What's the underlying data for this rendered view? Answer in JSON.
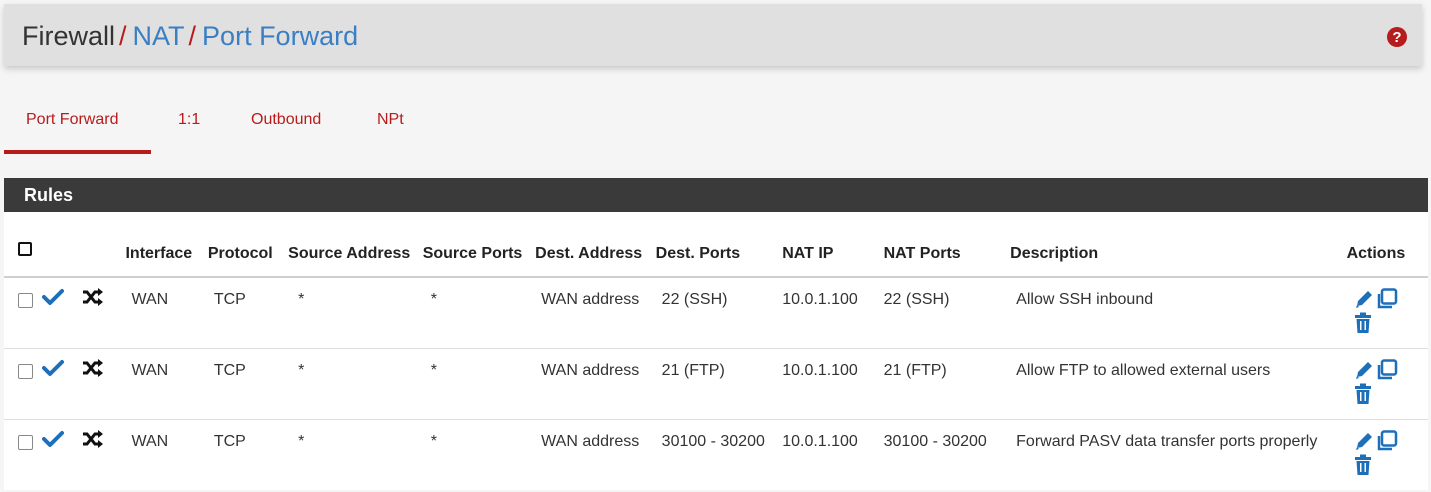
{
  "breadcrumb": {
    "root": "Firewall",
    "sep1": "/",
    "nat": "NAT",
    "sep2": "/",
    "current": "Port Forward"
  },
  "help_icon": "question-circle-icon",
  "tabs": [
    {
      "label": "Port Forward",
      "active": true
    },
    {
      "label": "1:1",
      "active": false
    },
    {
      "label": "Outbound",
      "active": false
    },
    {
      "label": "NPt",
      "active": false
    }
  ],
  "rules": {
    "title": "Rules",
    "columns": {
      "interface": "Interface",
      "protocol": "Protocol",
      "source_address": "Source Address",
      "source_ports": "Source Ports",
      "dest_address": "Dest. Address",
      "dest_ports": "Dest. Ports",
      "nat_ip": "NAT IP",
      "nat_ports": "NAT Ports",
      "description": "Description",
      "actions": "Actions"
    },
    "rows": [
      {
        "interface": "WAN",
        "protocol": "TCP",
        "source_address": "*",
        "source_ports": "*",
        "dest_address": "WAN address",
        "dest_ports": "22 (SSH)",
        "nat_ip": "10.0.1.100",
        "nat_ports": "22 (SSH)",
        "description": "Allow SSH inbound"
      },
      {
        "interface": "WAN",
        "protocol": "TCP",
        "source_address": "*",
        "source_ports": "*",
        "dest_address": "WAN address",
        "dest_ports": "21 (FTP)",
        "nat_ip": "10.0.1.100",
        "nat_ports": "21 (FTP)",
        "description": "Allow FTP to allowed external users"
      },
      {
        "interface": "WAN",
        "protocol": "TCP",
        "source_address": "*",
        "source_ports": "*",
        "dest_address": "WAN address",
        "dest_ports": "30100 - 30200",
        "nat_ip": "10.0.1.100",
        "nat_ports": "30100 - 30200",
        "description": "Forward PASV data transfer ports properly"
      }
    ]
  },
  "colors": {
    "accent_red": "#b71c1c",
    "link_blue": "#3a7fc4",
    "check_blue": "#1e6fba",
    "panel_header": "#3a3a3a"
  }
}
